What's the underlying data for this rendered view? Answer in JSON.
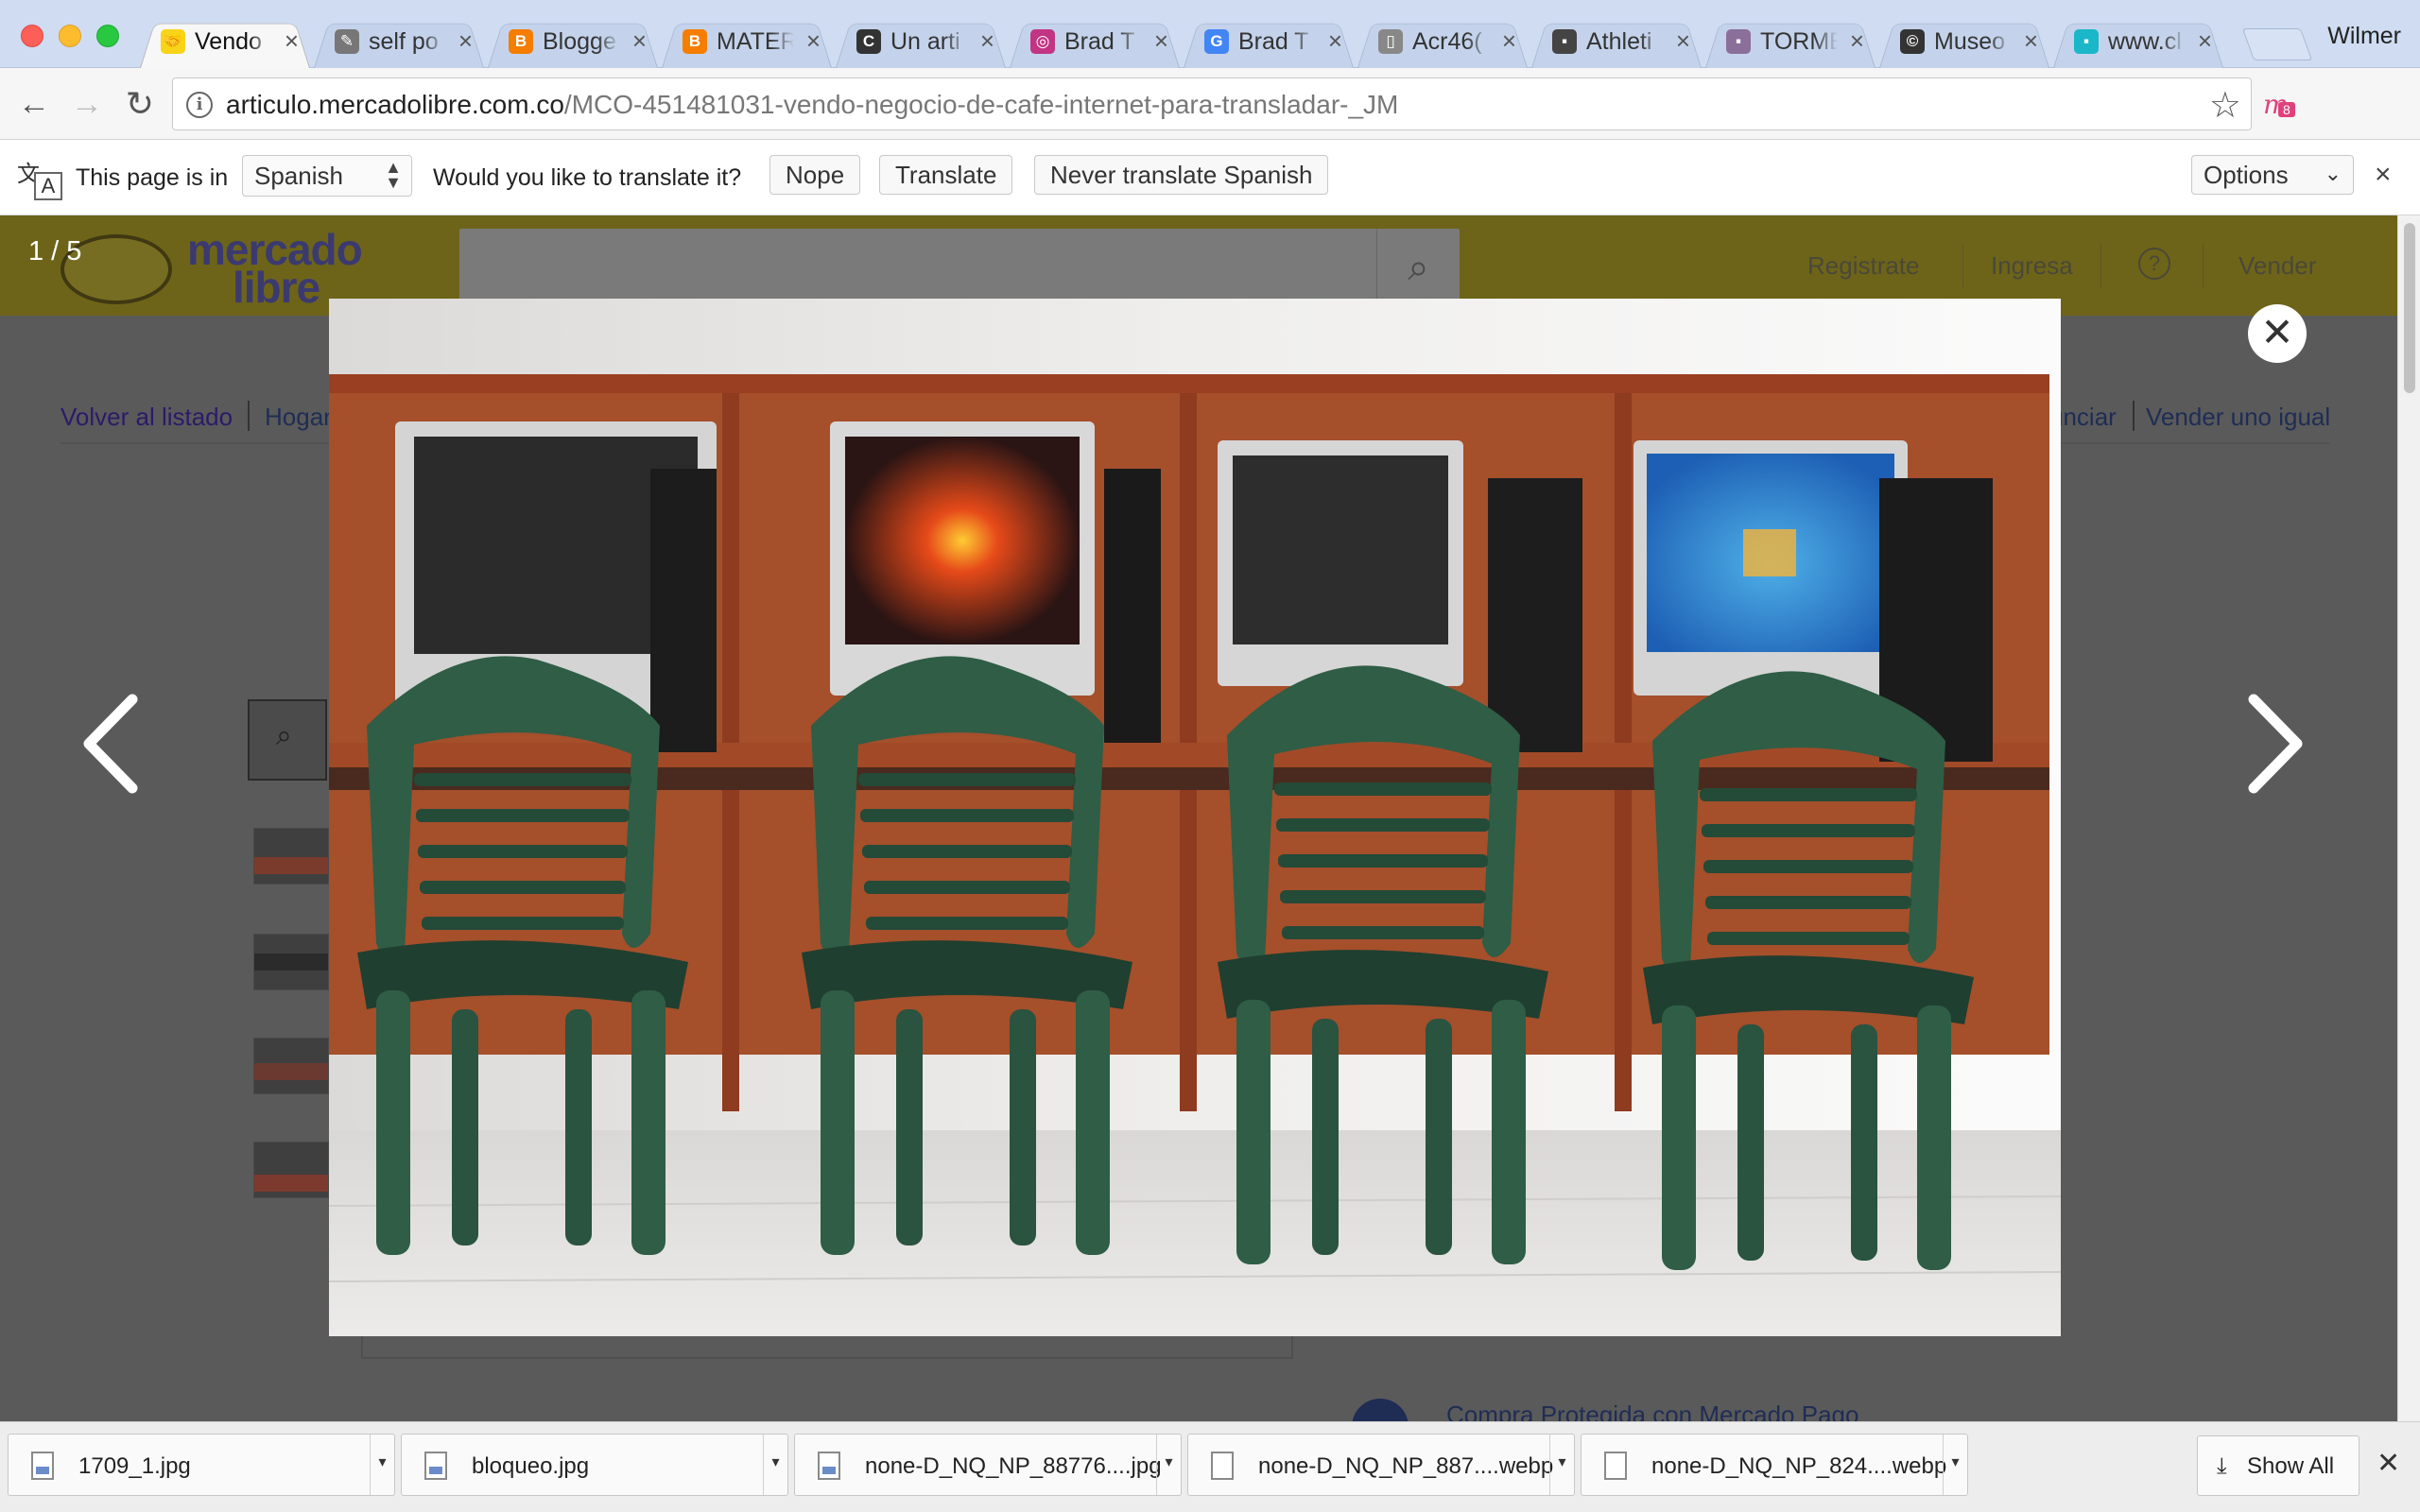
{
  "tabs": [
    {
      "title": "Vendo",
      "favicon": "mercadolibre-icon",
      "color": "#f7d417",
      "active": true
    },
    {
      "title": "self po",
      "favicon": "blog-avatar-icon",
      "color": "#777777"
    },
    {
      "title": "Blogge",
      "favicon": "blogger-icon",
      "color": "#f57d00"
    },
    {
      "title": "MATER",
      "favicon": "blogger-icon",
      "color": "#f57d00"
    },
    {
      "title": "Un arti",
      "favicon": "loading-spinner-icon",
      "color": "#333333"
    },
    {
      "title": "Brad T",
      "favicon": "instagram-icon",
      "color": "#c13584"
    },
    {
      "title": "Brad T",
      "favicon": "google-icon",
      "color": "#4285f4"
    },
    {
      "title": "Acr46(",
      "favicon": "document-icon",
      "color": "#888888"
    },
    {
      "title": "Athleti",
      "favicon": "site-icon",
      "color": "#444444"
    },
    {
      "title": "TORME",
      "favicon": "site-icon",
      "color": "#8a6f9a"
    },
    {
      "title": "Museo",
      "favicon": "copyright-icon",
      "color": "#333333"
    },
    {
      "title": "www.cl",
      "favicon": "site-icon",
      "color": "#19b7c9"
    }
  ],
  "profile_name": "Wilmer",
  "toolbar": {
    "url_host": "articulo.mercadolibre.com.co",
    "url_path": "/MCO-451481031-vendo-negocio-de-cafe-internet-para-transladar-_JM",
    "extension_badge": "8"
  },
  "translate_bar": {
    "page_in": "This page is in",
    "language": "Spanish",
    "question": "Would you like to translate it?",
    "nope": "Nope",
    "translate": "Translate",
    "never": "Never translate Spanish",
    "options": "Options"
  },
  "site": {
    "logo_line1": "mercado",
    "logo_line2": "libre",
    "registrate": "Registrate",
    "ingresa": "Ingresa",
    "help": "?",
    "vender": "Vender",
    "crumb_back": "Volver al listado",
    "crumb_hogar": "Hogar",
    "crumb_anunciar": "unciar",
    "crumb_vender_igual": "Vender uno igual",
    "protected_purchase": "Compra Protegida con Mercado Pago"
  },
  "lightbox": {
    "counter": "1 / 5"
  },
  "downloads": [
    {
      "name": "1709_1.jpg",
      "type": "image"
    },
    {
      "name": "bloqueo.jpg",
      "type": "image"
    },
    {
      "name": "none-D_NQ_NP_88776....jpg",
      "type": "image"
    },
    {
      "name": "none-D_NQ_NP_887....webp",
      "type": "file"
    },
    {
      "name": "none-D_NQ_NP_824....webp",
      "type": "file"
    }
  ],
  "show_all": "Show All",
  "colors": {
    "mercadolibre_yellow": "#fff159",
    "link_blue": "#3483fa",
    "chair_green": "#2f5d46",
    "desk_wood": "#b4562f"
  }
}
